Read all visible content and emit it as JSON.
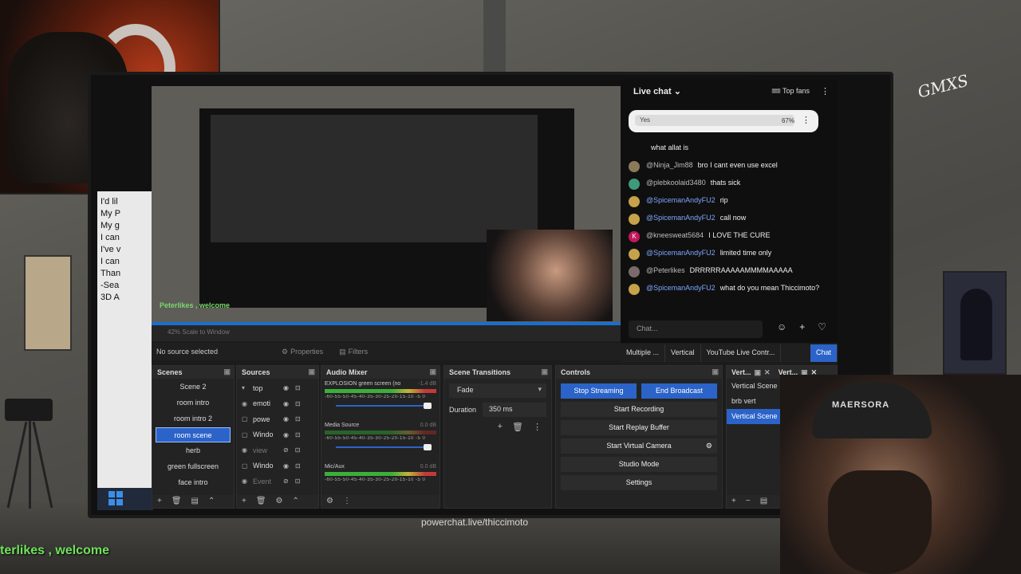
{
  "overlay": {
    "watermark": "powerchat.live/thiccimoto",
    "welcome_banner": "terlikes , welcome",
    "graffiti": "GMXS"
  },
  "left_doc": {
    "lines": [
      "I'd lil",
      "My P",
      "My g",
      "I can",
      "I've v",
      "I can",
      "",
      "Than",
      "-Sea",
      "3D A"
    ]
  },
  "preview": {
    "ticker": "Peterlikes , welcome",
    "bottom_strip": "42%   Scale to Window"
  },
  "properties_bar": {
    "no_source": "No source selected",
    "properties_label": "Properties",
    "filters_label": "Filters"
  },
  "chat": {
    "header_title": "Live chat",
    "top_fans": "Top fans",
    "poll": {
      "option": "Yes",
      "percent": "67%",
      "percent_value": 67
    },
    "messages": [
      {
        "user": "",
        "text": "what allat is",
        "style": "plain",
        "avatar": ""
      },
      {
        "user": "@Ninja_Jim88",
        "text": "bro I cant even use excel",
        "style": "plain",
        "avatar": ""
      },
      {
        "user": "@plebkoolaid3480",
        "text": "thats sick",
        "style": "plain",
        "avatar": ""
      },
      {
        "user": "@SpicemanAndyFU2",
        "text": "rip",
        "style": "mod",
        "avatar": ""
      },
      {
        "user": "@SpicemanAndyFU2",
        "text": "call now",
        "style": "mod",
        "avatar": ""
      },
      {
        "user": "@kneesweat5684",
        "text": "I LOVE THE CURE",
        "style": "plain",
        "avatar": "K"
      },
      {
        "user": "@SpicemanAndyFU2",
        "text": "limited time only",
        "style": "mod",
        "avatar": ""
      },
      {
        "user": "@Peterlikes",
        "text": "DRRRRRAAAAAMMMMAAAAA",
        "style": "plain",
        "avatar": ""
      },
      {
        "user": "@SpicemanAndyFU2",
        "text": "what do you mean Thiccimoto?",
        "style": "mod",
        "avatar": ""
      }
    ],
    "input_placeholder": "Chat...",
    "emoji_icon": "☺",
    "add_icon": "+",
    "heart_icon": "♡"
  },
  "dock_tabs": [
    "Multiple ...",
    "Vertical",
    "YouTube Live Contr...",
    "Chat"
  ],
  "scenes": {
    "title": "Scenes",
    "items": [
      "Scene 2",
      "room intro",
      "room intro 2",
      "room scene",
      "herb",
      "green fullscreen",
      "face intro"
    ],
    "active_index": 3
  },
  "sources": {
    "title": "Sources",
    "items": [
      {
        "icon": "▾",
        "name": "top"
      },
      {
        "icon": "◉",
        "name": "emoti"
      },
      {
        "icon": "▢",
        "name": "powe"
      },
      {
        "icon": "▢",
        "name": "Windo"
      },
      {
        "icon": "◉",
        "name": "view"
      },
      {
        "icon": "▢",
        "name": "Windo"
      },
      {
        "icon": "◉",
        "name": "Event"
      }
    ]
  },
  "audio_mixer": {
    "title": "Audio Mixer",
    "channels": [
      {
        "name": "EXPLOSION green screen (no",
        "db": "-1.4 dB",
        "level": 0.9
      },
      {
        "name": "Media Source",
        "db": "0.0 dB",
        "level": 0.7
      },
      {
        "name": "Mic/Aux",
        "db": "0.0 dB",
        "level": 0.95
      }
    ],
    "scale": "-60-55-50-45-40-35-30-25-20-15-10 -5 0"
  },
  "transitions": {
    "title": "Scene Transitions",
    "selected": "Fade",
    "duration_label": "Duration",
    "duration_value": "350 ms"
  },
  "controls": {
    "title": "Controls",
    "stop_streaming": "Stop Streaming",
    "end_broadcast": "End Broadcast",
    "start_recording": "Start Recording",
    "start_replay": "Start Replay Buffer",
    "start_virtual": "Start Virtual Camera",
    "studio_mode": "Studio Mode",
    "settings": "Settings"
  },
  "vertical": {
    "title": "Vert...",
    "title2": "Vert...",
    "items": [
      "Vertical Scene",
      "brb vert",
      "Vertical Scene"
    ],
    "active_index": 2
  },
  "hat_text": "MAERSORA"
}
